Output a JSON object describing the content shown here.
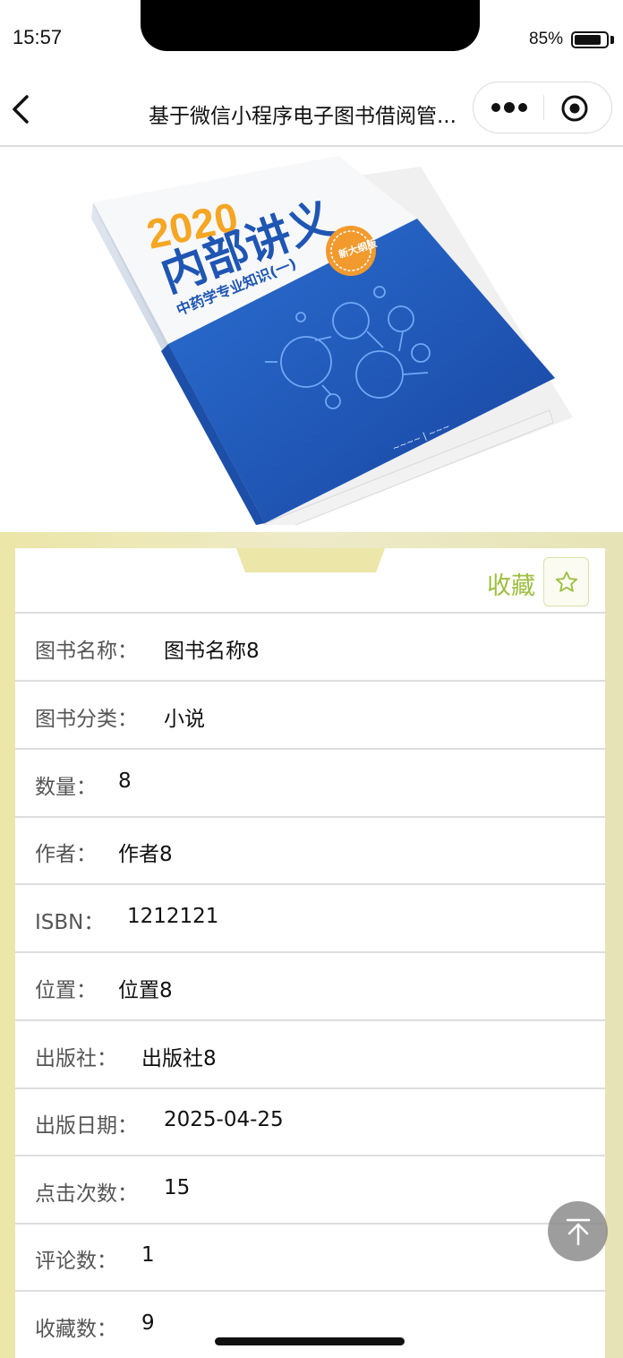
{
  "status_bar": {
    "time": "15:57",
    "battery_text": "85%",
    "battery_level": 0.85
  },
  "nav": {
    "title": "基于微信小程序电子图书借阅管...",
    "back_icon": "chevron-left-icon",
    "more_icon": "more-dots-icon",
    "close_icon": "target-circle-icon"
  },
  "cover": {
    "year": "2020",
    "title": "内部讲义",
    "subtitle": "中药学专业知识(一)",
    "badge": "新大纲版",
    "colors": {
      "blue": "#1f56b4",
      "orange": "#f5a623"
    }
  },
  "detail": {
    "favorite_label": "收藏",
    "favorite_icon": "star-outline-icon",
    "accent_color": "#9cbf3f",
    "rows": [
      {
        "label": "图书名称：",
        "value": "图书名称8"
      },
      {
        "label": "图书分类：",
        "value": "小说"
      },
      {
        "label": "数量：",
        "value": "8"
      },
      {
        "label": "作者：",
        "value": "作者8"
      },
      {
        "label": "ISBN：",
        "value": "1212121"
      },
      {
        "label": "位置：",
        "value": "位置8"
      },
      {
        "label": "出版社：",
        "value": "出版社8"
      },
      {
        "label": "出版日期：",
        "value": "2025-04-25"
      },
      {
        "label": "点击次数：",
        "value": "15"
      },
      {
        "label": "评论数：",
        "value": "1"
      },
      {
        "label": "收藏数：",
        "value": "9"
      }
    ]
  },
  "scroll_top_icon": "arrow-up-to-top-icon"
}
